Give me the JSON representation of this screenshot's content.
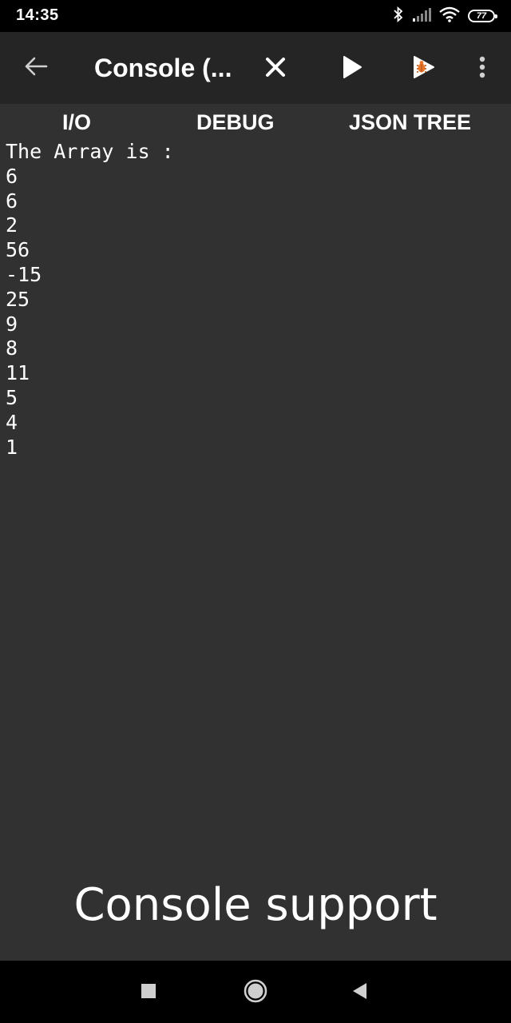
{
  "status_bar": {
    "time": "14:35",
    "battery": "77",
    "icons": [
      "bluetooth-icon",
      "signal-icon",
      "wifi-icon",
      "battery-icon"
    ]
  },
  "app_bar": {
    "title": "Console (...",
    "icons": [
      "back-arrow-icon",
      "close-icon",
      "play-icon",
      "debug-run-icon",
      "more-vert-icon"
    ]
  },
  "tabs": [
    {
      "label": "I/O"
    },
    {
      "label": "DEBUG"
    },
    {
      "label": "JSON TREE"
    }
  ],
  "console": {
    "lines": [
      "The Array is :",
      "6",
      "6",
      "2",
      "56",
      "-15",
      "25",
      "9",
      "8",
      "11",
      "5",
      "4",
      "1"
    ]
  },
  "caption": "Console support",
  "nav_bar": {
    "icons": [
      "recents-square-icon",
      "home-circle-icon",
      "back-triangle-icon"
    ]
  },
  "colors": {
    "app_bar_bg": "#252525",
    "content_bg": "#313131",
    "debug_accent": "#e8762b"
  }
}
